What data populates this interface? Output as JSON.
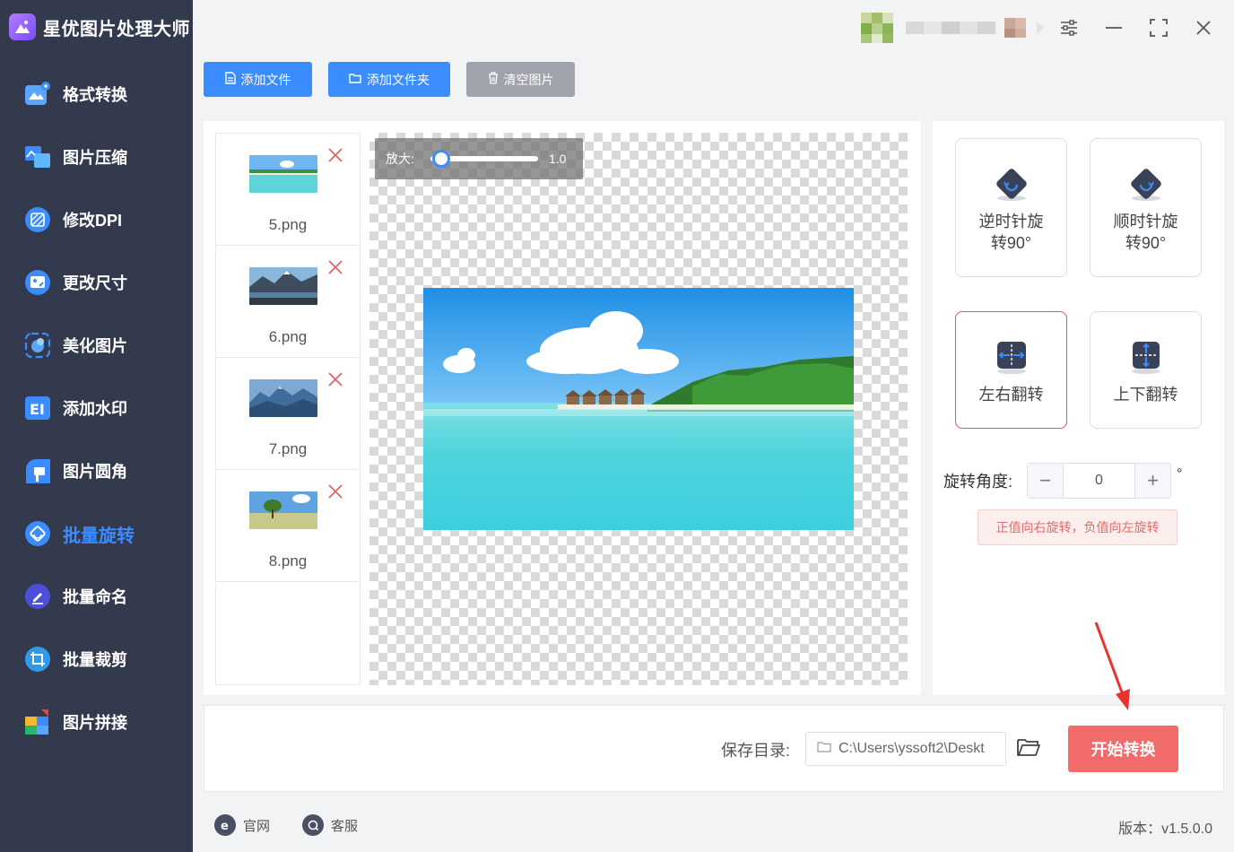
{
  "app": {
    "title": "星优图片处理大师",
    "logo_icon": "image-logo-icon"
  },
  "colors": {
    "accent": "#3b8cff",
    "sidebar_bg": "#333a4d",
    "danger": "#f26b6b",
    "clear_btn": "#a0a3ab"
  },
  "sidebar": {
    "items": [
      {
        "label": "格式转换",
        "icon": "format-convert-icon",
        "active": false
      },
      {
        "label": "图片压缩",
        "icon": "image-compress-icon",
        "active": false
      },
      {
        "label": "修改DPI",
        "icon": "dpi-icon",
        "active": false
      },
      {
        "label": "更改尺寸",
        "icon": "resize-icon",
        "active": false
      },
      {
        "label": "美化图片",
        "icon": "beautify-icon",
        "active": false
      },
      {
        "label": "添加水印",
        "icon": "watermark-icon",
        "active": false
      },
      {
        "label": "图片圆角",
        "icon": "rounded-corner-icon",
        "active": false
      },
      {
        "label": "批量旋转",
        "icon": "batch-rotate-icon",
        "active": true
      },
      {
        "label": "批量命名",
        "icon": "batch-rename-icon",
        "active": false
      },
      {
        "label": "批量裁剪",
        "icon": "batch-crop-icon",
        "active": false
      },
      {
        "label": "图片拼接",
        "icon": "image-stitch-icon",
        "active": false
      }
    ]
  },
  "toolbar": {
    "add_file": "添加文件",
    "add_folder": "添加文件夹",
    "clear_images": "清空图片"
  },
  "files": [
    {
      "name": "5.png"
    },
    {
      "name": "6.png"
    },
    {
      "name": "7.png"
    },
    {
      "name": "8.png"
    }
  ],
  "preview": {
    "zoom_label": "放大:",
    "zoom_value": "1.0"
  },
  "operations": {
    "rotate_ccw_line1": "逆时针旋",
    "rotate_ccw_line2": "转90°",
    "rotate_cw_line1": "顺时针旋",
    "rotate_cw_line2": "转90°",
    "flip_horizontal": "左右翻转",
    "flip_vertical": "上下翻转",
    "selected": "flip_horizontal"
  },
  "rotation": {
    "label": "旋转角度:",
    "value": "0",
    "unit": "°",
    "hint": "正值向右旋转，负值向左旋转"
  },
  "output": {
    "save_label": "保存目录:",
    "save_path": "C:\\Users\\yssoft2\\Deskt",
    "start_button": "开始转换"
  },
  "footer": {
    "website": "官网",
    "support": "客服",
    "version": "版本：v1.5.0.0"
  }
}
